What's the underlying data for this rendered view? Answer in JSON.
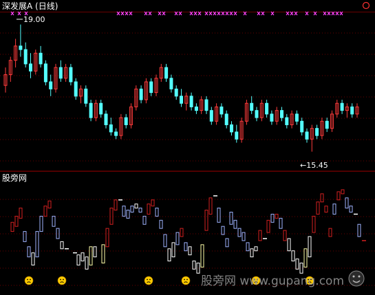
{
  "header": {
    "title": "深发展A (日线)",
    "corner_icon": "circle-icon"
  },
  "lower_panel": {
    "title": "股旁网"
  },
  "watermark": {
    "text": "股旁网 www.gupang.com",
    "icon": "smiley-logo-icon"
  },
  "colors": {
    "background": "#000000",
    "up": "#ff3b3b",
    "down": "#54ffff",
    "gridline": "#6a0000",
    "divider": "#a00000",
    "signal_marker": "#ff44ff",
    "box_red": "#d42020",
    "box_blue": "#9fb4ff",
    "box_white": "#ffffff",
    "box_yellow": "#ffffaa",
    "sad_face": "#ffcc00"
  },
  "chart_data": [
    {
      "type": "candlestick",
      "title": "深发展A (日线)",
      "annotations": [
        {
          "text": "19.00",
          "kind": "high"
        },
        {
          "text": "←15.45",
          "kind": "low"
        }
      ],
      "signal_markers": "x-row",
      "ylim": [
        15.0,
        19.3
      ],
      "grid": true,
      "candles": [
        [
          17.3,
          17.8,
          17.1,
          17.6
        ],
        [
          17.6,
          18.1,
          17.4,
          18.0
        ],
        [
          18.0,
          18.6,
          17.8,
          18.4
        ],
        [
          18.4,
          19.0,
          18.1,
          18.3
        ],
        [
          18.3,
          18.5,
          17.8,
          17.9
        ],
        [
          17.9,
          18.2,
          17.5,
          17.7
        ],
        [
          17.7,
          18.3,
          17.6,
          18.2
        ],
        [
          18.2,
          18.4,
          17.8,
          17.9
        ],
        [
          17.9,
          18.0,
          17.3,
          17.4
        ],
        [
          17.4,
          17.6,
          17.0,
          17.2
        ],
        [
          17.2,
          17.9,
          17.1,
          17.8
        ],
        [
          17.8,
          18.0,
          17.4,
          17.5
        ],
        [
          17.5,
          17.9,
          17.4,
          17.8
        ],
        [
          17.8,
          17.9,
          17.3,
          17.4
        ],
        [
          17.4,
          17.5,
          16.9,
          17.0
        ],
        [
          17.0,
          17.3,
          16.8,
          17.2
        ],
        [
          17.2,
          17.3,
          16.7,
          16.8
        ],
        [
          16.8,
          16.9,
          16.3,
          16.4
        ],
        [
          16.4,
          16.9,
          16.3,
          16.8
        ],
        [
          16.8,
          16.9,
          16.4,
          16.5
        ],
        [
          16.5,
          16.6,
          16.1,
          16.2
        ],
        [
          16.2,
          16.4,
          15.9,
          16.0
        ],
        [
          16.0,
          16.1,
          15.8,
          15.9
        ],
        [
          15.9,
          16.5,
          15.8,
          16.4
        ],
        [
          16.4,
          16.5,
          16.1,
          16.2
        ],
        [
          16.2,
          16.8,
          16.1,
          16.7
        ],
        [
          16.7,
          17.3,
          16.6,
          17.2
        ],
        [
          17.2,
          17.3,
          16.8,
          16.9
        ],
        [
          16.9,
          17.5,
          16.8,
          17.4
        ],
        [
          17.4,
          17.5,
          17.0,
          17.1
        ],
        [
          17.1,
          17.6,
          17.0,
          17.5
        ],
        [
          17.5,
          17.9,
          17.4,
          17.8
        ],
        [
          17.8,
          17.9,
          17.4,
          17.5
        ],
        [
          17.5,
          17.6,
          17.1,
          17.2
        ],
        [
          17.2,
          17.3,
          16.9,
          17.0
        ],
        [
          17.0,
          17.2,
          16.7,
          16.8
        ],
        [
          16.8,
          17.1,
          16.6,
          17.0
        ],
        [
          17.0,
          17.1,
          16.6,
          16.7
        ],
        [
          16.7,
          16.8,
          16.5,
          16.6
        ],
        [
          16.6,
          17.0,
          16.5,
          16.9
        ],
        [
          16.9,
          17.0,
          16.5,
          16.6
        ],
        [
          16.6,
          16.7,
          16.2,
          16.3
        ],
        [
          16.3,
          16.8,
          16.2,
          16.7
        ],
        [
          16.7,
          16.8,
          16.4,
          16.5
        ],
        [
          16.5,
          16.6,
          16.1,
          16.2
        ],
        [
          16.2,
          16.3,
          15.9,
          16.0
        ],
        [
          16.0,
          16.2,
          15.7,
          15.8
        ],
        [
          15.8,
          16.4,
          15.7,
          16.3
        ],
        [
          16.3,
          16.9,
          16.2,
          16.8
        ],
        [
          16.8,
          17.0,
          16.5,
          16.6
        ],
        [
          16.6,
          16.7,
          16.3,
          16.4
        ],
        [
          16.4,
          16.9,
          16.3,
          16.8
        ],
        [
          16.8,
          16.9,
          16.4,
          16.5
        ],
        [
          16.5,
          16.6,
          16.2,
          16.3
        ],
        [
          16.3,
          16.7,
          16.2,
          16.6
        ],
        [
          16.6,
          16.7,
          16.3,
          16.4
        ],
        [
          16.4,
          16.5,
          16.1,
          16.2
        ],
        [
          16.2,
          16.6,
          16.1,
          16.5
        ],
        [
          16.5,
          16.6,
          16.2,
          16.3
        ],
        [
          16.3,
          16.4,
          15.9,
          16.0
        ],
        [
          16.0,
          16.1,
          15.7,
          15.8
        ],
        [
          15.8,
          16.2,
          15.45,
          16.1
        ],
        [
          16.1,
          16.2,
          15.8,
          15.9
        ],
        [
          15.9,
          16.4,
          15.8,
          16.3
        ],
        [
          16.3,
          16.4,
          16.0,
          16.1
        ],
        [
          16.1,
          16.6,
          16.0,
          16.5
        ],
        [
          16.5,
          16.9,
          16.4,
          16.8
        ],
        [
          16.8,
          16.9,
          16.5,
          16.6
        ],
        [
          16.6,
          16.8,
          16.4,
          16.7
        ],
        [
          16.7,
          16.8,
          16.4,
          16.5
        ],
        [
          16.5,
          16.8,
          16.4,
          16.7
        ]
      ]
    },
    {
      "type": "box-indicator",
      "title": "股旁网",
      "ylim": [
        0,
        100
      ],
      "grid": true,
      "bars": [
        {
          "i": 1,
          "low": 55,
          "high": 64,
          "color": "red"
        },
        {
          "i": 2,
          "low": 60,
          "high": 70,
          "color": "red"
        },
        {
          "i": 3,
          "low": 68,
          "high": 78,
          "color": "red"
        },
        {
          "i": 4,
          "low": 45,
          "high": 55,
          "color": "blue"
        },
        {
          "i": 5,
          "low": 30,
          "high": 40,
          "color": "blue"
        },
        {
          "i": 6,
          "low": 22,
          "high": 34,
          "color": "white"
        },
        {
          "i": 7,
          "low": 30,
          "high": 55,
          "color": "blue"
        },
        {
          "i": 8,
          "low": 55,
          "high": 70,
          "color": "blue"
        },
        {
          "i": 9,
          "low": 70,
          "high": 80,
          "color": "red"
        },
        {
          "i": 10,
          "low": 78,
          "high": 85,
          "color": "red"
        },
        {
          "i": 11,
          "low": 60,
          "high": 70,
          "color": "blue"
        },
        {
          "i": 12,
          "low": 48,
          "high": 58,
          "color": "blue"
        },
        {
          "i": 13,
          "low": 38,
          "high": 45,
          "color": "white"
        },
        {
          "i": 14,
          "low": 36,
          "high": 38,
          "color": "white"
        },
        {
          "i": 16,
          "low": 32,
          "high": 34,
          "color": "white"
        },
        {
          "i": 17,
          "low": 22,
          "high": 32,
          "color": "white"
        },
        {
          "i": 18,
          "low": 26,
          "high": 34,
          "color": "white"
        },
        {
          "i": 19,
          "low": 18,
          "high": 30,
          "color": "white"
        },
        {
          "i": 20,
          "low": 22,
          "high": 40,
          "color": "yellow"
        },
        {
          "i": 21,
          "low": 30,
          "high": 40,
          "color": "white"
        },
        {
          "i": 23,
          "low": 24,
          "high": 42,
          "color": "yellow"
        },
        {
          "i": 24,
          "low": 40,
          "high": 58,
          "color": "red"
        },
        {
          "i": 25,
          "low": 62,
          "high": 78,
          "color": "red"
        },
        {
          "i": 26,
          "low": 76,
          "high": 86,
          "color": "red"
        },
        {
          "i": 27,
          "low": 84,
          "high": 86,
          "color": "white"
        },
        {
          "i": 28,
          "low": 70,
          "high": 80,
          "color": "blue"
        },
        {
          "i": 29,
          "low": 68,
          "high": 76,
          "color": "blue"
        },
        {
          "i": 30,
          "low": 74,
          "high": 80,
          "color": "blue"
        },
        {
          "i": 31,
          "low": 78,
          "high": 82,
          "color": "white"
        },
        {
          "i": 32,
          "low": 74,
          "high": 78,
          "color": "blue"
        },
        {
          "i": 33,
          "low": 62,
          "high": 70,
          "color": "blue"
        },
        {
          "i": 34,
          "low": 72,
          "high": 82,
          "color": "red"
        },
        {
          "i": 35,
          "low": 80,
          "high": 86,
          "color": "red"
        },
        {
          "i": 36,
          "low": 70,
          "high": 78,
          "color": "blue"
        },
        {
          "i": 37,
          "low": 58,
          "high": 66,
          "color": "blue"
        },
        {
          "i": 38,
          "low": 40,
          "high": 52,
          "color": "blue"
        },
        {
          "i": 39,
          "low": 26,
          "high": 38,
          "color": "white"
        },
        {
          "i": 40,
          "low": 30,
          "high": 44,
          "color": "white"
        },
        {
          "i": 41,
          "low": 42,
          "high": 54,
          "color": "blue"
        },
        {
          "i": 42,
          "low": 50,
          "high": 58,
          "color": "red"
        },
        {
          "i": 43,
          "low": 36,
          "high": 44,
          "color": "blue"
        },
        {
          "i": 44,
          "low": 32,
          "high": 40,
          "color": "white"
        },
        {
          "i": 45,
          "low": 18,
          "high": 26,
          "color": "white"
        },
        {
          "i": 46,
          "low": 14,
          "high": 24,
          "color": "white"
        },
        {
          "i": 47,
          "low": 20,
          "high": 42,
          "color": "yellow"
        },
        {
          "i": 48,
          "low": 56,
          "high": 76,
          "color": "red"
        },
        {
          "i": 49,
          "low": 72,
          "high": 88,
          "color": "red"
        },
        {
          "i": 50,
          "low": 88,
          "high": 90,
          "color": "white"
        },
        {
          "i": 51,
          "low": 64,
          "high": 78,
          "color": "blue"
        },
        {
          "i": 52,
          "low": 52,
          "high": 60,
          "color": "blue"
        },
        {
          "i": 53,
          "low": 40,
          "high": 48,
          "color": "blue"
        },
        {
          "i": 54,
          "low": 62,
          "high": 74,
          "color": "blue"
        },
        {
          "i": 55,
          "low": 58,
          "high": 66,
          "color": "blue"
        },
        {
          "i": 56,
          "low": 50,
          "high": 58,
          "color": "blue"
        },
        {
          "i": 57,
          "low": 46,
          "high": 54,
          "color": "blue"
        },
        {
          "i": 58,
          "low": 36,
          "high": 44,
          "color": "blue"
        },
        {
          "i": 59,
          "low": 30,
          "high": 38,
          "color": "white"
        },
        {
          "i": 60,
          "low": 36,
          "high": 40,
          "color": "white"
        },
        {
          "i": 61,
          "low": 46,
          "high": 56,
          "color": "red"
        },
        {
          "i": 62,
          "low": 46,
          "high": 48,
          "color": "white"
        },
        {
          "i": 63,
          "low": 54,
          "high": 66,
          "color": "red"
        },
        {
          "i": 64,
          "low": 64,
          "high": 72,
          "color": "blue"
        },
        {
          "i": 65,
          "low": 68,
          "high": 72,
          "color": "red"
        },
        {
          "i": 66,
          "low": 58,
          "high": 68,
          "color": "blue"
        },
        {
          "i": 67,
          "low": 46,
          "high": 56,
          "color": "red"
        },
        {
          "i": 68,
          "low": 36,
          "high": 48,
          "color": "white"
        },
        {
          "i": 69,
          "low": 26,
          "high": 36,
          "color": "white"
        },
        {
          "i": 70,
          "low": 18,
          "high": 28,
          "color": "white"
        },
        {
          "i": 71,
          "low": 14,
          "high": 24,
          "color": "white"
        },
        {
          "i": 72,
          "low": 20,
          "high": 38,
          "color": "yellow"
        },
        {
          "i": 73,
          "low": 30,
          "high": 50,
          "color": "white"
        },
        {
          "i": 74,
          "low": 54,
          "high": 70,
          "color": "red"
        },
        {
          "i": 75,
          "low": 72,
          "high": 84,
          "color": "red"
        },
        {
          "i": 76,
          "low": 84,
          "high": 92,
          "color": "red"
        },
        {
          "i": 77,
          "low": 74,
          "high": 80,
          "color": "red"
        },
        {
          "i": 78,
          "low": 50,
          "high": 58,
          "color": "red"
        },
        {
          "i": 79,
          "low": 72,
          "high": 82,
          "color": "blue"
        },
        {
          "i": 80,
          "low": 86,
          "high": 94,
          "color": "red"
        },
        {
          "i": 81,
          "low": 92,
          "high": 96,
          "color": "red"
        },
        {
          "i": 82,
          "low": 78,
          "high": 88,
          "color": "blue"
        },
        {
          "i": 83,
          "low": 74,
          "high": 80,
          "color": "blue"
        },
        {
          "i": 84,
          "low": 70,
          "high": 72,
          "color": "white"
        },
        {
          "i": 85,
          "low": 50,
          "high": 62,
          "color": "blue"
        },
        {
          "i": 86,
          "low": 44,
          "high": 46,
          "color": "red"
        }
      ],
      "sad_face_markers": [
        5,
        13,
        34,
        43,
        60,
        73
      ]
    }
  ]
}
